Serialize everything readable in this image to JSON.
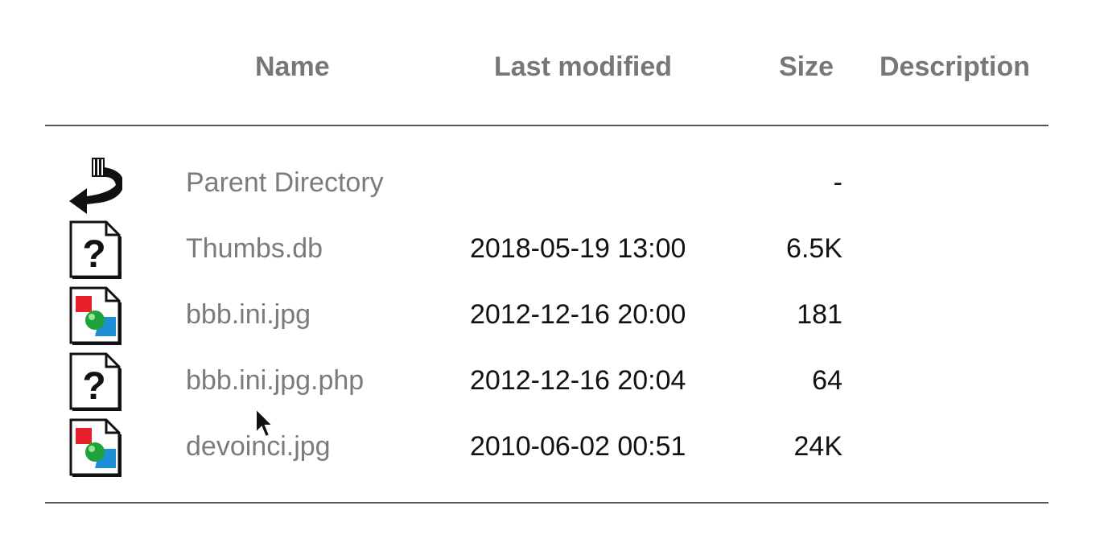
{
  "headers": {
    "name": "Name",
    "last_modified": "Last modified",
    "size": "Size",
    "description": "Description"
  },
  "rows": [
    {
      "icon": "back-arrow-icon",
      "name": "Parent Directory",
      "modified": "",
      "size": "-",
      "description": ""
    },
    {
      "icon": "unknown-file-icon",
      "name": "Thumbs.db",
      "modified": "2018-05-19 13:00",
      "size": "6.5K",
      "description": ""
    },
    {
      "icon": "image-file-icon",
      "name": "bbb.ini.jpg",
      "modified": "2012-12-16 20:00",
      "size": "181",
      "description": ""
    },
    {
      "icon": "unknown-file-icon",
      "name": "bbb.ini.jpg.php",
      "modified": "2012-12-16 20:04",
      "size": "64",
      "description": ""
    },
    {
      "icon": "image-file-icon",
      "name": "devoinci.jpg",
      "modified": "2010-06-02 00:51",
      "size": "24K",
      "description": ""
    }
  ],
  "colors": {
    "link": "#7b7b7b",
    "header": "#777777",
    "rule": "#555555"
  }
}
